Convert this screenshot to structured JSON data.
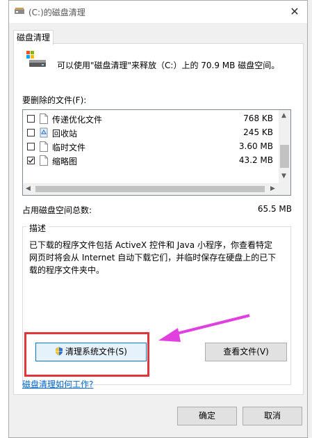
{
  "window": {
    "title": "(C:)的磁盘清理",
    "close_glyph": "✕"
  },
  "tab": {
    "label": "磁盘清理"
  },
  "header": {
    "text": "可以使用\"磁盘清理\"来释放（C:）上的 70.9 MB 磁盘空间。"
  },
  "files_label": "要删除的文件(F):",
  "files": [
    {
      "name": "传递优化文件",
      "size": "768 KB",
      "checked": false,
      "icon": "file-icon"
    },
    {
      "name": "回收站",
      "size": "245 KB",
      "checked": false,
      "icon": "recycle-bin-icon"
    },
    {
      "name": "临时文件",
      "size": "3.60 MB",
      "checked": false,
      "icon": "file-icon"
    },
    {
      "name": "缩略图",
      "size": "43.2 MB",
      "checked": true,
      "icon": "file-icon"
    }
  ],
  "total": {
    "label": "占用磁盘空间总数:",
    "value": "65.5 MB"
  },
  "description": {
    "title": "描述",
    "text": "已下载的程序文件包括 ActiveX 控件和 Java 小程序，你查看特定网页时将会从 Internet 自动下载它们，并临时保存在硬盘上的已下载的程序文件夹中。"
  },
  "buttons": {
    "cleanup_system": "清理系统文件(S)",
    "view_files": "查看文件(V)",
    "ok": "确定",
    "cancel": "取消"
  },
  "help_link": "磁盘清理如何工作?",
  "colors": {
    "highlight_box": "#e0363a",
    "annotation_arrow": "#e040e0",
    "link": "#0066cc"
  }
}
